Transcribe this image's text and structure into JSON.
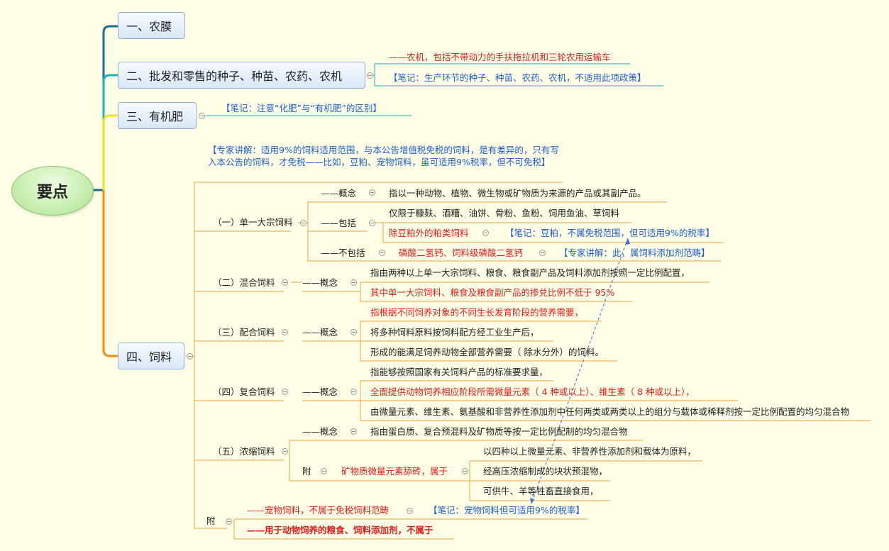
{
  "root": {
    "label": "要点"
  },
  "branches": {
    "b1": {
      "label": "一、农膜"
    },
    "b2": {
      "label": "二、批发和零售的种子、种苗、农药、农机",
      "note1": "——农机，包括不带动力的手扶拖拉机和三轮农用运输车",
      "note2": "【笔记：生产环节的种子、种苗、农药、农机，不适用此项政策】"
    },
    "b3": {
      "label": "三、有机肥",
      "note": "【笔记：注意“化肥”与“有机肥”的区别】"
    },
    "b4": {
      "label": "四、饲料",
      "expert": "【专家讲解：适用9%的饲料适用范围，与本公告增值税免税的饲料，是有差异的，只有写入本公告的饲料，才免税——比如，豆粕、宠物饲料，虽可适用9%税率，但不可免税】",
      "s1": {
        "label": "（一）单一大宗饲料",
        "concept_label": "——概念",
        "concept": "指以一种动物、植物、微生物或矿物质为来源的产品或其副产品。",
        "include_label": "——包括",
        "include1": "仅限于糠麸、酒糟、油饼、骨粉、鱼粉、饲用鱼油、草饲料",
        "include2": "除豆粕外的粕类饲料",
        "include2_note": "【笔记：豆粕，不属免税范围，但可适用9%的税率】",
        "exclude_label": "——不包括",
        "exclude": "磷酸二氢钙、饲料级磷酸二氢钙",
        "exclude_note": "【专家讲解：此，属饲料添加剂范畴】"
      },
      "s2": {
        "label": "（二）混合饲料",
        "concept_label": "——概念",
        "line1": "指由两种以上单一大宗饲料、粮食、粮食副产品及饲料添加剂按照一定比例配置，",
        "line2": "其中单一大宗饲料、粮食及粮食副产品的掺兑比例不低于 95%"
      },
      "s3": {
        "label": "（三）配合饲料",
        "concept_label": "——概念",
        "line1": "指根据不同饲养对象的不同生长发育阶段的营养需要，",
        "line2": "将多种饲料原料按饲料配方经工业生产后，",
        "line3": "形成的能满足饲养动物全部营养需要（ 除水分外）的饲料。"
      },
      "s4": {
        "label": "（四）复合饲料",
        "concept_label": "——概念",
        "line1": "指能够按照国家有关饲料产品的标准要求量，",
        "line2": "全面提供动物饲养相应阶段所需微量元素（ 4 种或以上）、维生素（ 8 种或以上），",
        "line3": "由微量元素、维生素、氨基酸和非营养性添加剂中任何两类或两类以上的组分与载体或稀释剂按一定比例配置的均匀混合物"
      },
      "s5": {
        "label": "（五）浓缩饲料",
        "concept_label": "——概念",
        "concept": "指由蛋白质、复合预混料及矿物质等按一定比例配制的均匀混合物",
        "attach_label": "附",
        "attach": "矿物质微量元素舔砖，属于",
        "attach1": "以四种以上微量元素、非营养性添加剂和载体为原料，",
        "attach2": "经高压浓缩制成的块状预混物，",
        "attach3": "可供牛、羊等牲畜直接食用，"
      },
      "s6": {
        "label": "附",
        "line1": "——宠物饲料，不属于免税饲料范畴",
        "line1_note": "【笔记：宠物饲料但可适用9%的税率】",
        "line2": "——用于动物饲养的粮食、饲料添加剂，不属于"
      }
    }
  },
  "colors": {
    "branch1": "#1a6e8e",
    "branch2": "#17b3b8",
    "branch3": "#f1e021",
    "branch4": "#f08c10",
    "feed_lines": "#e8a53a",
    "red_text": "#e21b1b",
    "blue_text": "#1f5fcf",
    "box_border": "#8fb2d7"
  }
}
